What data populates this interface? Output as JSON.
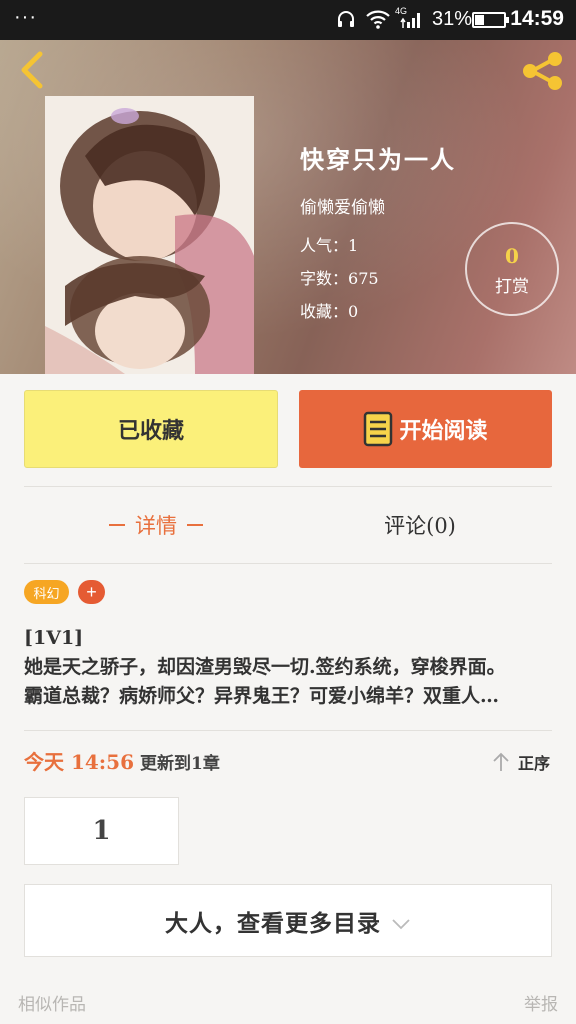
{
  "status_bar": {
    "menu_dots": "···",
    "network_label": "4G",
    "battery_percent": "31%",
    "battery_level": 0.31,
    "time": "14:59"
  },
  "book": {
    "title": "快穿只为一人",
    "author": "偷懒爱偷懒",
    "popularity_label": "人气：",
    "popularity": "1",
    "word_count_label": "字数：",
    "word_count": "675",
    "favorites_label": "收藏：",
    "favorites": "0",
    "tip_count": "0",
    "tip_label": "打赏"
  },
  "actions": {
    "favorite_label": "已收藏",
    "read_label": "开始阅读"
  },
  "tabs": {
    "detail": "详情",
    "comments": "评论(0)"
  },
  "tags": {
    "genre": "科幻",
    "add": "+"
  },
  "description": {
    "line1": "[1V1]",
    "line2": "她是天之骄子，却因渣男毁尽一切.签约系统，穿梭界面。",
    "line3": "霸道总裁？病娇师父？异界鬼王？可爱小绵羊？双重人…"
  },
  "update": {
    "time": "今天 14:56",
    "text": "更新到1章",
    "sort_label": "正序"
  },
  "catalog": {
    "page": "1",
    "more_label": "大人，查看更多目录"
  },
  "footer": {
    "similar": "相似作品",
    "report": "举报"
  },
  "colors": {
    "accent": "#e8703d",
    "favorite_bg": "#fbf07a",
    "read_bg": "#e7673d",
    "icon_yellow": "#f5c433"
  },
  "icons": {
    "back": "chevron-left-icon",
    "share": "share-icon",
    "read": "book-icon",
    "sort": "arrow-up-icon",
    "expand": "chevron-down-icon"
  }
}
